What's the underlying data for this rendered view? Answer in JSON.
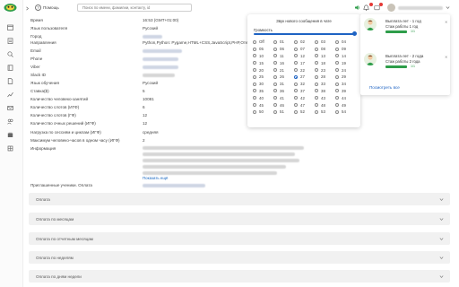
{
  "topbar": {
    "help_label": "Помощь",
    "search_placeholder": "Поиск по имени, фамилии, контакту, id"
  },
  "details": [
    {
      "label": "Время",
      "value": "16:53 (GMT+01:00)"
    },
    {
      "label": "Язык пользователя",
      "value": "Русский"
    },
    {
      "label": "Город",
      "value": ""
    },
    {
      "label": "Направления",
      "value": "Python,Python: Pygame,HTML+CSS,JavaScript,PHP,Оте"
    },
    {
      "label": "Email",
      "value": ""
    },
    {
      "label": "Phone",
      "value": ""
    },
    {
      "label": "Viber",
      "value": ""
    },
    {
      "label": "Slack ID",
      "value": ""
    },
    {
      "label": "Язык обучения",
      "value": "Русский"
    },
    {
      "label": "Ставка($)",
      "value": "5"
    },
    {
      "label": "Количество человеко-занятий",
      "value": "10081"
    },
    {
      "label": "Количество слотов (ИГФ)",
      "value": "6"
    },
    {
      "label": "Количество слотов (ГФ)",
      "value": "12"
    },
    {
      "label": "Количество очных решений (ИГФ)",
      "value": "12"
    },
    {
      "label": "Нагрузка по сессиям и циклам (ИГФ)",
      "value": "средняя"
    },
    {
      "label": "Максимум человеко-часов в одном часу (ИГФ)",
      "value": "2"
    },
    {
      "label": "Информация",
      "value": ""
    },
    {
      "label": "Приглашенные ученики. Оплата",
      "value": ""
    }
  ],
  "show_more_label": "Показать ещё",
  "accordions": [
    "Оплата",
    "Оплата по месяцам",
    "Оплата по отчетным месяцам",
    "Оплата по неделям",
    "Оплата по дням недели"
  ],
  "sound_popup": {
    "title": "Звук нового сообщения в чате",
    "volume_label": "Громкость",
    "volume": 1.0,
    "options": [
      "Off",
      "01",
      "02",
      "03",
      "04",
      "05",
      "06",
      "07",
      "08",
      "09",
      "10",
      "11",
      "12",
      "13",
      "14",
      "15",
      "16",
      "17",
      "18",
      "19",
      "20",
      "21",
      "22",
      "23",
      "24",
      "25",
      "26",
      "27",
      "28",
      "29",
      "30",
      "31",
      "32",
      "33",
      "34",
      "35",
      "36",
      "37",
      "38",
      "39",
      "40",
      "41",
      "42",
      "43",
      "44",
      "45",
      "46",
      "47",
      "48",
      "49",
      "50",
      "51",
      "52",
      "53",
      "54"
    ],
    "selected": "27"
  },
  "notifications": {
    "items": [
      {
        "title": "Выплата лет - 1 год",
        "subtitle": "Стаж работы 1 год",
        "count": "1/1",
        "progress": 1.0
      },
      {
        "title": "Выплата лет - 2 года",
        "subtitle": "Стаж работы 2 года",
        "count": "1/1",
        "progress": 1.0
      }
    ],
    "show_all_label": "Посмотреть все"
  },
  "colors": {
    "accent": "#1e63c3",
    "success": "#2e9d4a",
    "badge": "#e53935",
    "accordion_bg": "#f1f1f1"
  }
}
